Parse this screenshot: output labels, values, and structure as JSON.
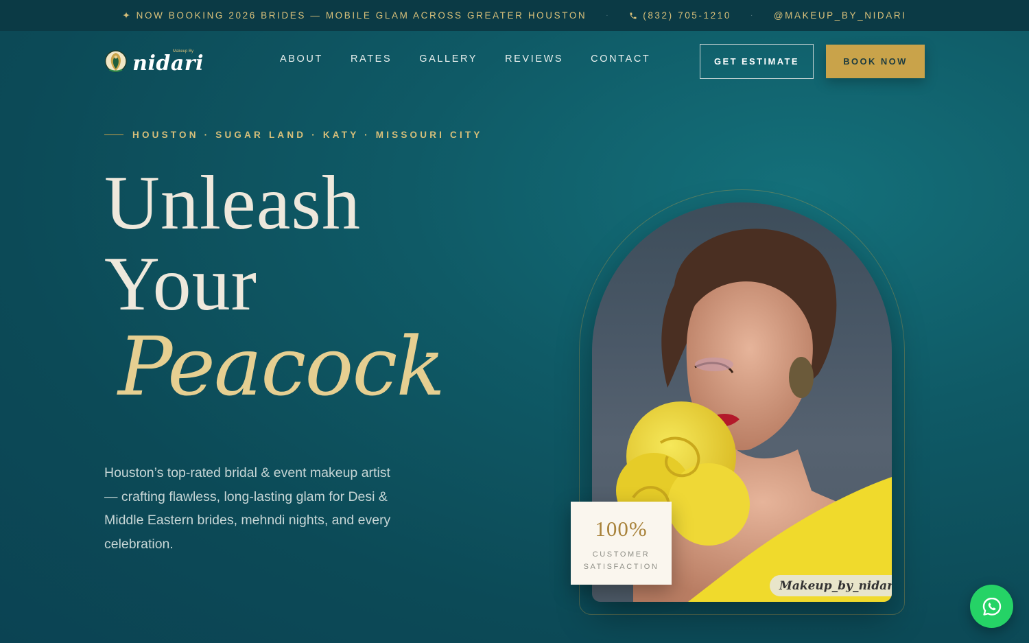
{
  "announcement": {
    "booking": "✦ NOW BOOKING 2026 BRIDES — MOBILE GLAM ACROSS GREATER HOUSTON",
    "separator": "·",
    "phone": "(832) 705-1210",
    "handle": "@MAKEUP_BY_NIDARI",
    "phone_icon": "phone-icon"
  },
  "logo": {
    "word": "nidari",
    "tagline": "Makeup By"
  },
  "nav": {
    "items": [
      "ABOUT",
      "RATES",
      "GALLERY",
      "REVIEWS",
      "CONTACT"
    ]
  },
  "buttons": {
    "estimate": "GET ESTIMATE",
    "book": "BOOK NOW"
  },
  "hero": {
    "eyebrow": "HOUSTON · SUGAR LAND · KATY · MISSOURI CITY",
    "title_line1": "Unleash",
    "title_line2": "Your",
    "title_line3": "Peacock",
    "description": "Houston’s top-rated bridal & event makeup artist — crafting flawless, long-lasting glam for Desi & Middle Eastern brides, mehndi nights, and every celebration."
  },
  "portrait": {
    "watermark": "Makeup_by_nidari"
  },
  "stat": {
    "value": "100%",
    "label": "CUSTOMER SATISFACTION"
  },
  "colors": {
    "accent": "#c9a34a",
    "background": "#0f5a66",
    "topbar": "#0b3a45",
    "whatsapp": "#25d366"
  },
  "icons": {
    "whatsapp": "whatsapp-icon"
  }
}
